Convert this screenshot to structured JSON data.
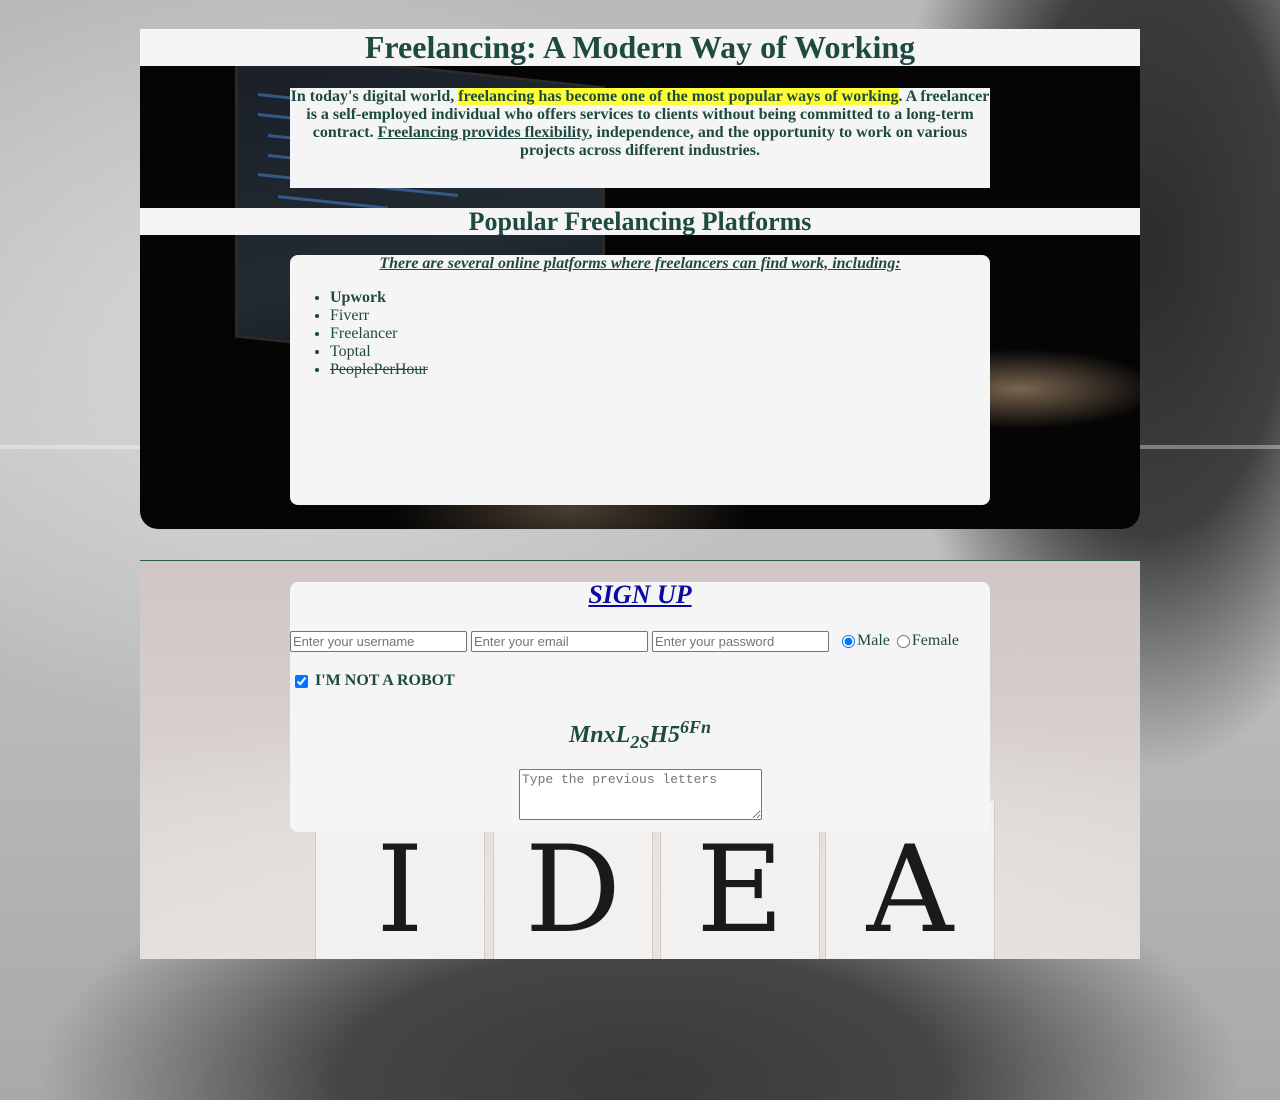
{
  "header": {
    "title": "Freelancing: A Modern Way of Working"
  },
  "intro": {
    "text_1": "In today's digital world, ",
    "highlight": "freelancing has become one of the most popular ways of working",
    "text_2": ". A freelancer is a self-employed individual who offers services to clients without being committed to a long-term contract. ",
    "underlined": "Freelancing provides flexibility",
    "text_3": ", independence, and the opportunity to work on various projects across different industries."
  },
  "platforms": {
    "heading": "Popular Freelancing Platforms",
    "lead": "There are several online platforms where freelancers can find work, including:",
    "items": [
      "Upwork",
      "Fiverr",
      "Freelancer",
      "Toptal",
      "PeoplePerHour"
    ]
  },
  "signup": {
    "title": "SIGN UP",
    "username_placeholder": "Enter your username",
    "email_placeholder": "Enter your email",
    "password_placeholder": "Enter your password",
    "gender_male": "Male",
    "gender_female": "Female",
    "selected_gender": "Male",
    "robot_label": "I'M NOT A ROBOT",
    "robot_checked": true,
    "captcha": {
      "main": "MnxL",
      "sub": "2S",
      "mid": "H5",
      "sup": "6Fn"
    },
    "captcha_placeholder": "Type the previous letters"
  },
  "background_blocks": [
    "I",
    "D",
    "E",
    "A"
  ],
  "colors": {
    "text": "#1f4a41",
    "highlight": "#ffff33",
    "link": "#0a0aa0",
    "panel": "#f5f5f5"
  }
}
